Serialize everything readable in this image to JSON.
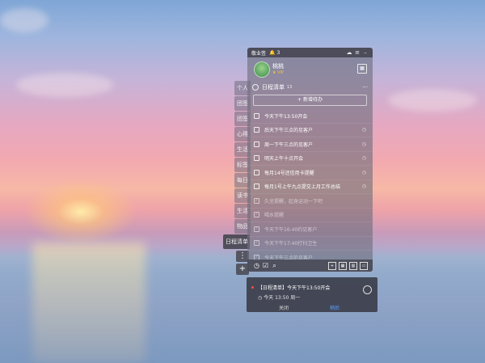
{
  "app": {
    "title": "敬业签",
    "notification_count": "3"
  },
  "user": {
    "name": "桃桃",
    "badge": "VIP"
  },
  "side_tabs": [
    "个人",
    "团签",
    "团签",
    "心得",
    "生活",
    "标签",
    "每日",
    "读书",
    "生活",
    "物品"
  ],
  "active_tab": "日程清单",
  "list": {
    "title": "日程清单",
    "count": "13",
    "new_todo": "+ 新增待办"
  },
  "items": [
    {
      "text": "今天下午13:50开会",
      "done": false,
      "reminder": false
    },
    {
      "text": "后天下午三点的见客户",
      "done": false,
      "reminder": true
    },
    {
      "text": "周一下午三点的见客户",
      "done": false,
      "reminder": true
    },
    {
      "text": "明天上午十点开会",
      "done": false,
      "reminder": true
    },
    {
      "text": "每月14号还信用卡提醒",
      "done": false,
      "reminder": true
    },
    {
      "text": "每月1号上午九点提交上月工作总结",
      "done": false,
      "reminder": true
    },
    {
      "text": "久坐提醒，起身运动一下吧",
      "done": true,
      "reminder": false
    },
    {
      "text": "喝水提醒",
      "done": true,
      "reminder": false
    },
    {
      "text": "今天下午16:40约见客户",
      "done": true,
      "reminder": false
    },
    {
      "text": "今天下午17:40打扫卫生",
      "done": true,
      "reminder": false
    },
    {
      "text": "今天下午三点的见客户",
      "done": true,
      "reminder": false
    }
  ],
  "notification": {
    "title": "【日程清单】今天下午13:50开会",
    "time": "今天 13:50 周一",
    "close_label": "关闭",
    "later_label": "稍后"
  },
  "colors": {
    "accent": "#5aa0ff",
    "notify_dot": "#ff4a4a",
    "vip": "#f5c542"
  }
}
